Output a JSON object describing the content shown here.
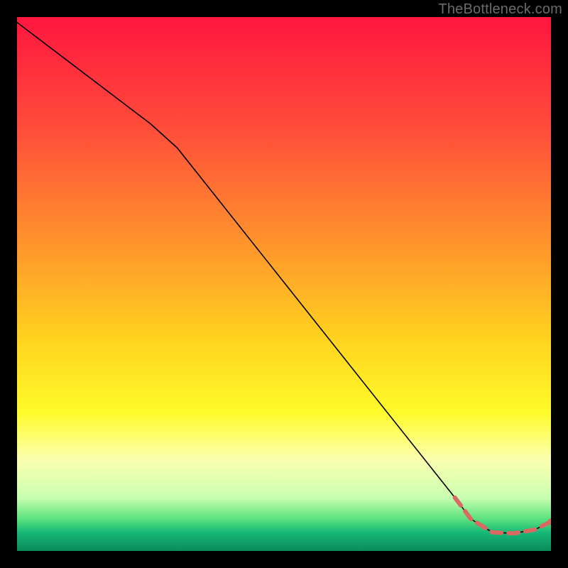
{
  "watermark": "TheBottleneck.com",
  "chart_data": {
    "type": "line",
    "title": "",
    "xlabel": "",
    "ylabel": "",
    "xlim": [
      0,
      100
    ],
    "ylim": [
      0,
      100
    ],
    "grid": false,
    "legend": false,
    "gradient_stops": [
      {
        "offset": 0.0,
        "color": "#ff163f"
      },
      {
        "offset": 0.2,
        "color": "#ff4a3a"
      },
      {
        "offset": 0.4,
        "color": "#ff8c2e"
      },
      {
        "offset": 0.6,
        "color": "#ffd21f"
      },
      {
        "offset": 0.74,
        "color": "#fffb2a"
      },
      {
        "offset": 0.83,
        "color": "#fbffb0"
      },
      {
        "offset": 0.9,
        "color": "#c9ffb0"
      },
      {
        "offset": 0.94,
        "color": "#5be27e"
      },
      {
        "offset": 0.965,
        "color": "#17b978"
      },
      {
        "offset": 1.0,
        "color": "#0a8a5a"
      }
    ],
    "series": [
      {
        "name": "black-curve",
        "color": "#000000",
        "style": "solid",
        "width": 1.6,
        "points": [
          {
            "x": 0,
            "y": 99
          },
          {
            "x": 25,
            "y": 80
          },
          {
            "x": 30,
            "y": 75.5
          },
          {
            "x": 82,
            "y": 10
          },
          {
            "x": 85,
            "y": 6
          },
          {
            "x": 89,
            "y": 3.5
          },
          {
            "x": 93,
            "y": 3.3
          },
          {
            "x": 97,
            "y": 4
          },
          {
            "x": 100,
            "y": 5.5
          }
        ]
      },
      {
        "name": "red-dashed-tail",
        "color": "#d86a63",
        "style": "dashed",
        "width": 6,
        "dash": [
          14,
          10
        ],
        "points": [
          {
            "x": 82,
            "y": 10
          },
          {
            "x": 85,
            "y": 6
          },
          {
            "x": 89,
            "y": 3.5
          },
          {
            "x": 93,
            "y": 3.3
          },
          {
            "x": 97,
            "y": 4
          },
          {
            "x": 100,
            "y": 5.5
          }
        ],
        "end_marker": {
          "x": 100,
          "y": 5.5,
          "r": 4.5
        }
      }
    ]
  }
}
